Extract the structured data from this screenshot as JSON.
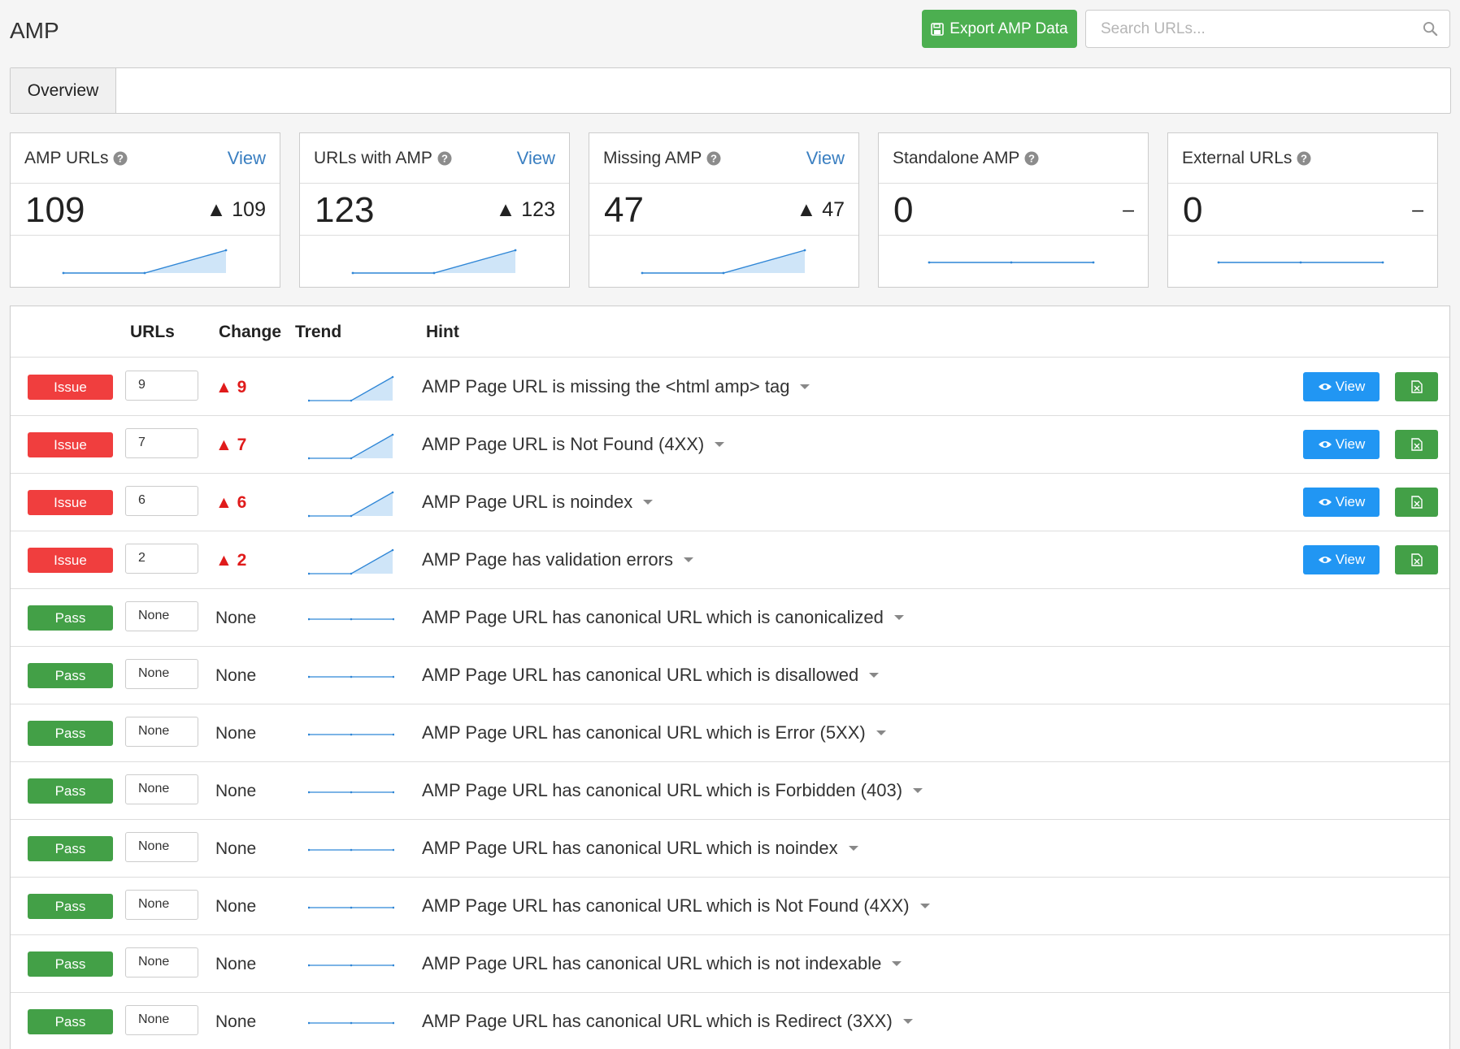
{
  "header": {
    "title": "AMP",
    "export_label": "Export AMP Data",
    "search_placeholder": "Search URLs..."
  },
  "tabs": [
    {
      "label": "Overview",
      "active": true
    }
  ],
  "cards": [
    {
      "title": "AMP URLs",
      "view_label": "View",
      "value": "109",
      "change": "▲ 109",
      "trend": "up"
    },
    {
      "title": "URLs with AMP",
      "view_label": "View",
      "value": "123",
      "change": "▲ 123",
      "trend": "up"
    },
    {
      "title": "Missing AMP",
      "view_label": "View",
      "value": "47",
      "change": "▲ 47",
      "trend": "up"
    },
    {
      "title": "Standalone AMP",
      "view_label": "",
      "value": "0",
      "change": "–",
      "trend": "flat"
    },
    {
      "title": "External URLs",
      "view_label": "",
      "value": "0",
      "change": "–",
      "trend": "flat"
    }
  ],
  "table": {
    "headers": {
      "urls": "URLs",
      "change": "Change",
      "trend": "Trend",
      "hint": "Hint"
    },
    "view_label": "View",
    "rows": [
      {
        "status": "Issue",
        "urls": "9",
        "change": "▲ 9",
        "trend": "up",
        "hint": "AMP Page URL is missing the <html amp> tag",
        "actions": true
      },
      {
        "status": "Issue",
        "urls": "7",
        "change": "▲ 7",
        "trend": "up",
        "hint": "AMP Page URL is Not Found (4XX)",
        "actions": true
      },
      {
        "status": "Issue",
        "urls": "6",
        "change": "▲ 6",
        "trend": "up",
        "hint": "AMP Page URL is noindex",
        "actions": true
      },
      {
        "status": "Issue",
        "urls": "2",
        "change": "▲ 2",
        "trend": "up",
        "hint": "AMP Page has validation errors",
        "actions": true
      },
      {
        "status": "Pass",
        "urls": "None",
        "change": "None",
        "trend": "flat",
        "hint": "AMP Page URL has canonical URL which is canonicalized",
        "actions": false
      },
      {
        "status": "Pass",
        "urls": "None",
        "change": "None",
        "trend": "flat",
        "hint": "AMP Page URL has canonical URL which is disallowed",
        "actions": false
      },
      {
        "status": "Pass",
        "urls": "None",
        "change": "None",
        "trend": "flat",
        "hint": "AMP Page URL has canonical URL which is Error (5XX)",
        "actions": false
      },
      {
        "status": "Pass",
        "urls": "None",
        "change": "None",
        "trend": "flat",
        "hint": "AMP Page URL has canonical URL which is Forbidden (403)",
        "actions": false
      },
      {
        "status": "Pass",
        "urls": "None",
        "change": "None",
        "trend": "flat",
        "hint": "AMP Page URL has canonical URL which is noindex",
        "actions": false
      },
      {
        "status": "Pass",
        "urls": "None",
        "change": "None",
        "trend": "flat",
        "hint": "AMP Page URL has canonical URL which is Not Found (4XX)",
        "actions": false
      },
      {
        "status": "Pass",
        "urls": "None",
        "change": "None",
        "trend": "flat",
        "hint": "AMP Page URL has canonical URL which is not indexable",
        "actions": false
      },
      {
        "status": "Pass",
        "urls": "None",
        "change": "None",
        "trend": "flat",
        "hint": "AMP Page URL has canonical URL which is Redirect (3XX)",
        "actions": false
      }
    ]
  },
  "colors": {
    "issue": "#f03e3e",
    "pass": "#43a047",
    "link": "#3a7fc1",
    "view_button": "#2196f3",
    "export_button": "#4caf50",
    "change_up": "#e01b1b",
    "sparkline": "#2f86d6",
    "sparkline_fill": "#cfe5f8"
  }
}
